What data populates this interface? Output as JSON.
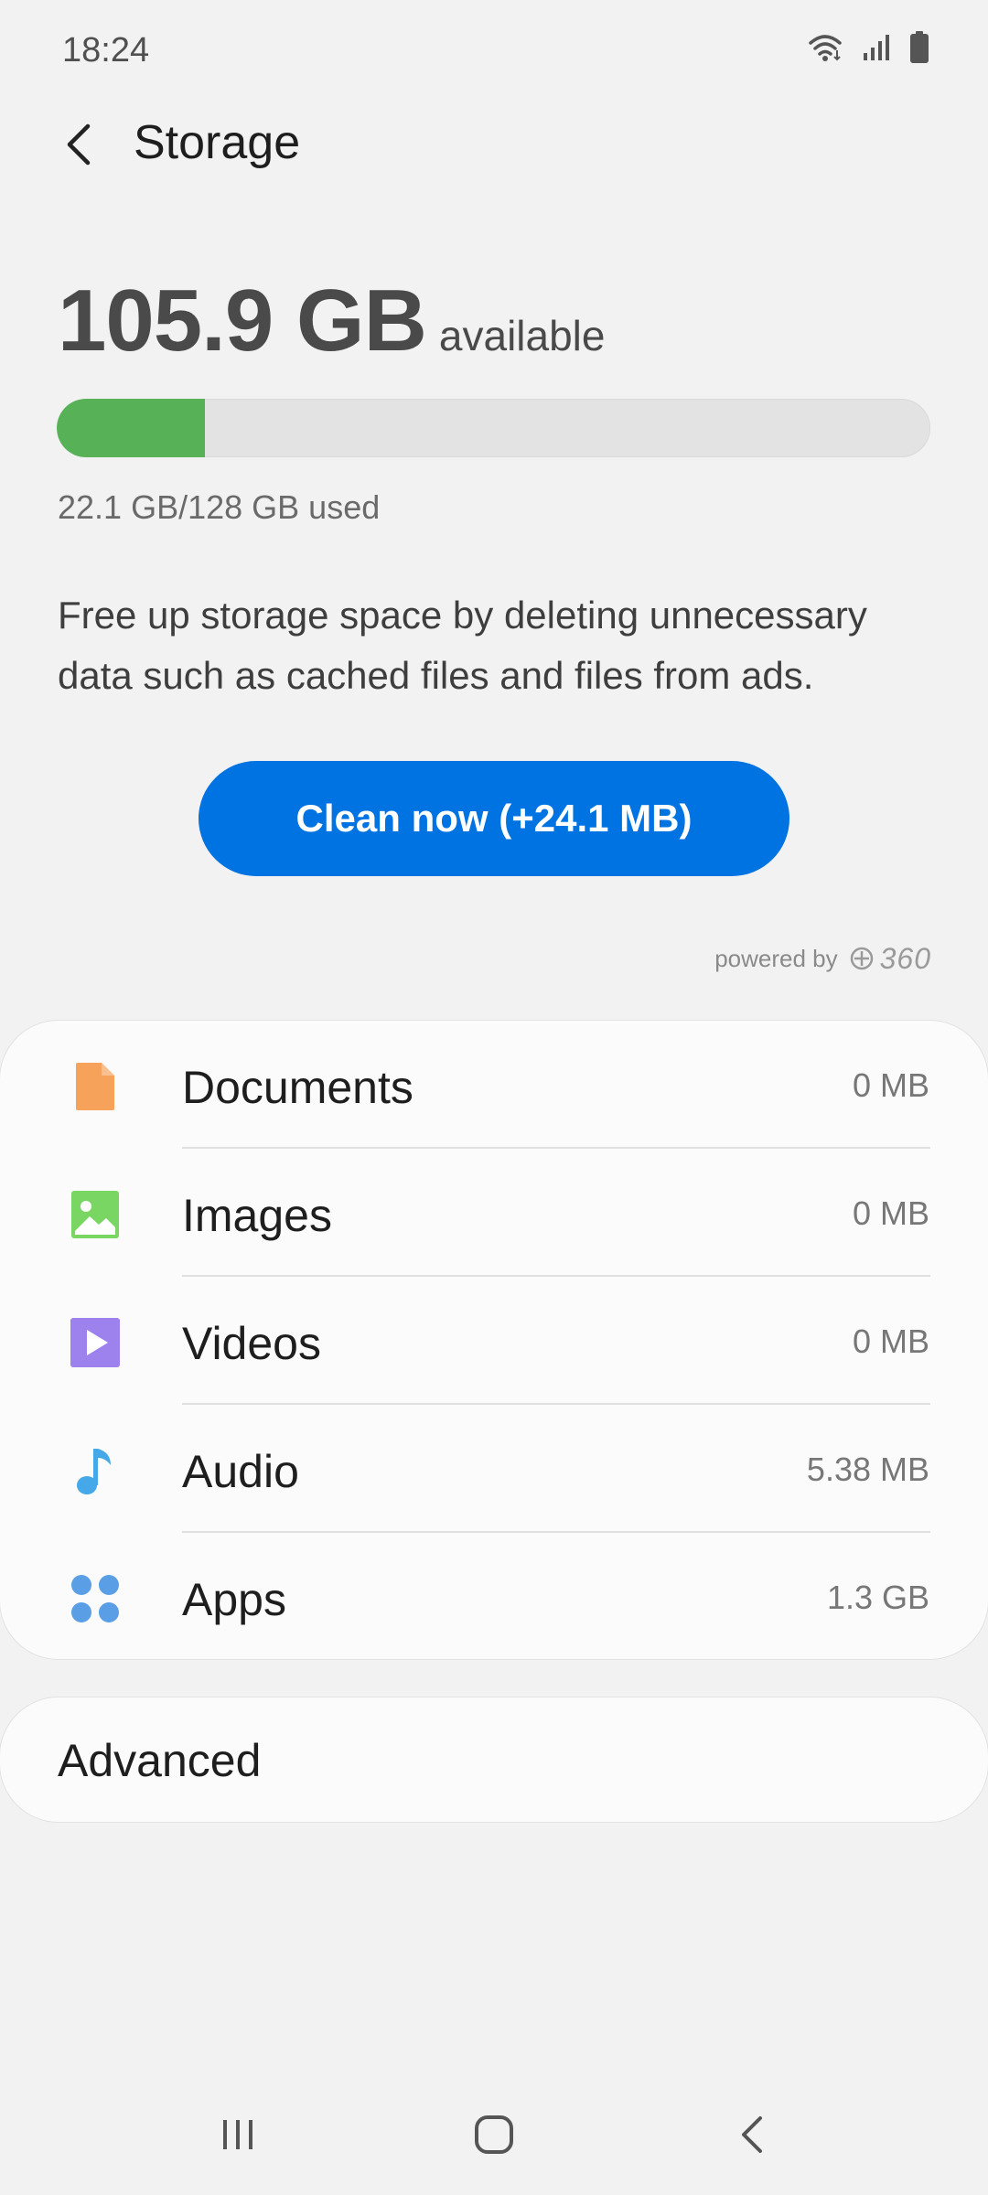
{
  "status_bar": {
    "time": "18:24",
    "icons": [
      "wifi-icon",
      "signal-icon",
      "battery-icon"
    ]
  },
  "header": {
    "title": "Storage",
    "back_icon": "back-arrow-icon"
  },
  "summary": {
    "available_amount": "105.9 GB",
    "available_label": "available",
    "used_text": "22.1 GB/128 GB used",
    "used_fraction": 0.17
  },
  "description": "Free up storage space by deleting unnecessary data such as cached files and files from ads.",
  "clean_button": {
    "label": "Clean now (+24.1 MB)"
  },
  "powered_by": {
    "label": "powered by",
    "brand": "360"
  },
  "categories": [
    {
      "label": "Documents",
      "size": "0 MB",
      "icon": "document-icon",
      "color": "#f6a25a"
    },
    {
      "label": "Images",
      "size": "0 MB",
      "icon": "image-icon",
      "color": "#7ad662"
    },
    {
      "label": "Videos",
      "size": "0 MB",
      "icon": "video-icon",
      "color": "#9d82ee"
    },
    {
      "label": "Audio",
      "size": "5.38 MB",
      "icon": "music-note-icon",
      "color": "#45a8e8"
    },
    {
      "label": "Apps",
      "size": "1.3 GB",
      "icon": "apps-icon",
      "color": "#5a9ee6"
    }
  ],
  "advanced": {
    "label": "Advanced"
  },
  "nav_bar": {
    "icons": [
      "recents-icon",
      "home-icon",
      "back-icon"
    ]
  },
  "colors": {
    "progress_fill": "#57b257",
    "accent_blue": "#0073e2"
  }
}
